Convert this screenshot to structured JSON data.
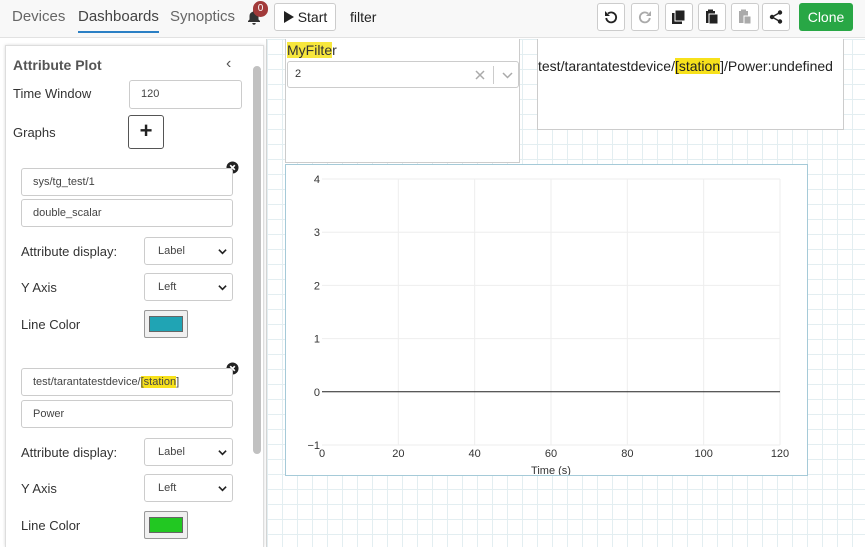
{
  "nav": {
    "tabs": [
      {
        "label": "Devices",
        "active": false
      },
      {
        "label": "Dashboards",
        "active": true
      },
      {
        "label": "Synoptics",
        "active": false
      }
    ],
    "notification_count": "0",
    "start_label": "Start",
    "filter_name": "filter",
    "clone_label": "Clone",
    "toolbar_icons": [
      "undo-icon",
      "redo-icon",
      "copy-icon",
      "paste-icon",
      "delete-icon",
      "share-icon"
    ]
  },
  "panel": {
    "title": "Attribute Plot",
    "time_window_label": "Time Window",
    "time_window_value": "120",
    "graphs_label": "Graphs",
    "graphs": [
      {
        "device": "sys/tg_test/1",
        "attribute": "double_scalar",
        "display_label": "Attribute display:",
        "display_value": "Label",
        "yaxis_label": "Y Axis",
        "yaxis_value": "Left",
        "color_label": "Line Color",
        "color": "#20a4b4"
      },
      {
        "device_prefix": "test/tarantatestdevice/",
        "device_highlight": "[station",
        "device_suffix": "]",
        "attribute": "Power",
        "display_label": "Attribute display:",
        "display_value": "Label",
        "yaxis_label": "Y Axis",
        "yaxis_value": "Left",
        "color_label": "Line Color",
        "color": "#22c822"
      }
    ]
  },
  "filter_widget": {
    "title_highlight": "MyFilte",
    "title_rest": "r",
    "value": "2"
  },
  "label_widget": {
    "prefix": "test/tarantatestdevice/",
    "highlight": "[station",
    "suffix": "]/Power:undefined"
  },
  "chart_data": {
    "type": "line",
    "x": [
      0,
      120
    ],
    "series": [
      {
        "values": [
          0,
          0
        ],
        "color": "#222222"
      }
    ],
    "xlabel": "Time (s)",
    "ylabel": "",
    "xlim": [
      0,
      120
    ],
    "ylim": [
      -1,
      4
    ],
    "xticks": [
      0,
      20,
      40,
      60,
      80,
      100,
      120
    ],
    "yticks": [
      -1,
      0,
      1,
      2,
      3,
      4
    ],
    "grid": true
  }
}
